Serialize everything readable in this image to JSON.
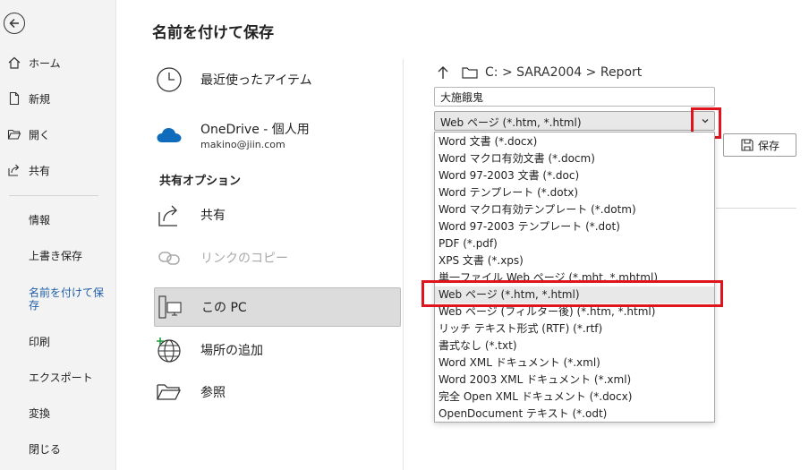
{
  "nav": {
    "items": [
      {
        "label": "ホーム",
        "icon": "home-icon"
      },
      {
        "label": "新規",
        "icon": "new-document-icon"
      },
      {
        "label": "開く",
        "icon": "folder-open-icon"
      },
      {
        "label": "共有",
        "icon": "share-icon"
      }
    ],
    "sub_items": [
      {
        "label": "情報"
      },
      {
        "label": "上書き保存"
      },
      {
        "label": "名前を付けて保存",
        "active": true
      },
      {
        "label": "印刷"
      },
      {
        "label": "エクスポート"
      },
      {
        "label": "変換"
      },
      {
        "label": "閉じる"
      }
    ]
  },
  "page": {
    "title": "名前を付けて保存"
  },
  "locations": {
    "recent": "最近使ったアイテム",
    "onedrive": {
      "label": "OneDrive - 個人用",
      "account": "makino@jiin.com"
    },
    "share_heading": "共有オプション",
    "share": "共有",
    "copy_link": "リンクのコピー",
    "this_pc": "この PC",
    "add_place": "場所の追加",
    "browse": "参照"
  },
  "save_panel": {
    "path": "C: > SARA2004 > Report",
    "filename": "大施餓鬼",
    "filetype": "Web ページ (*.htm, *.html)",
    "save_label": "保存",
    "filetype_options": [
      "Word 文書 (*.docx)",
      "Word マクロ有効文書 (*.docm)",
      "Word 97-2003 文書 (*.doc)",
      "Word テンプレート (*.dotx)",
      "Word マクロ有効テンプレート (*.dotm)",
      "Word 97-2003 テンプレート (*.dot)",
      "PDF (*.pdf)",
      "XPS 文書 (*.xps)",
      "単一ファイル Web ページ (*.mht, *.mhtml)",
      "Web ページ (*.htm, *.html)",
      "Web ページ (フィルター後) (*.htm, *.html)",
      "リッチ テキスト形式 (RTF) (*.rtf)",
      "書式なし (*.txt)",
      "Word XML ドキュメント (*.xml)",
      "Word 2003 XML ドキュメント (*.xml)",
      "完全 Open XML ドキュメント (*.docx)",
      "OpenDocument テキスト (*.odt)"
    ],
    "selected_index": 9
  },
  "colors": {
    "accent": "#1d5ea8",
    "highlight": "#e0141c",
    "onedrive": "#0f6cbd"
  }
}
